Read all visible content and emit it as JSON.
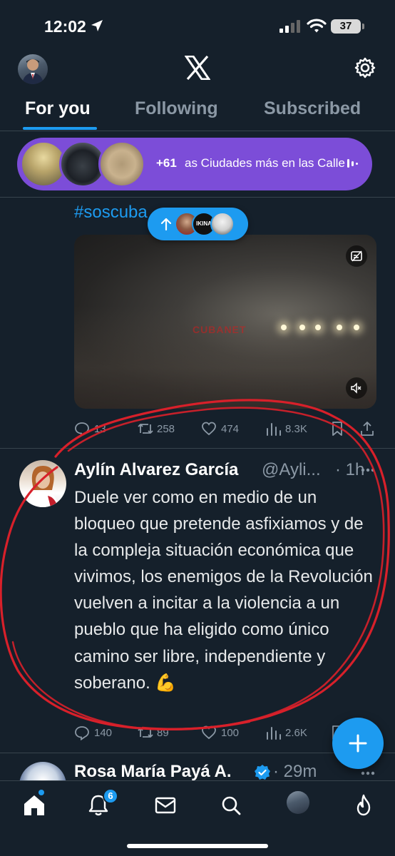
{
  "status_bar": {
    "time": "12:02",
    "battery": "37"
  },
  "header": {
    "logo": "X",
    "icons": [
      "avatar",
      "x-logo-icon",
      "gear-icon"
    ]
  },
  "tabs": [
    {
      "label": "For you",
      "active": true
    },
    {
      "label": "Following",
      "active": false
    },
    {
      "label": "Subscribed",
      "active": false
    }
  ],
  "spaces": {
    "count": "+61",
    "title": "as Ciudades más en las Calles"
  },
  "tweet1": {
    "hashtag": "#soscuba",
    "watermark": "CUBANET",
    "stats": {
      "replies": "13",
      "reposts": "258",
      "likes": "474",
      "views": "8.3K"
    }
  },
  "new_posts_pill": {
    "icon": "arrow-up-icon",
    "avatar_label": "IKINA"
  },
  "tweet2": {
    "name": "Aylín Alvarez García",
    "handle": "@Ayli...",
    "time": "· 1h",
    "text": "Duele ver como en medio de un bloqueo que pretende asfixiamos y de la compleja situación económica que vivimos, los enemigos de la Revolución vuelven a incitar a la violencia a un pueblo que ha eligido como único camino ser libre, independiente y soberano. 💪",
    "stats": {
      "replies": "140",
      "reposts": "89",
      "likes": "100",
      "views": "2.6K"
    }
  },
  "tweet3": {
    "name": "Rosa María Payá A.",
    "time": "· 29m"
  },
  "bottom_nav": {
    "notifications_badge": "6"
  },
  "colors": {
    "background": "#15202b",
    "accent": "#1d9bf0",
    "spaces": "#7c4dd8",
    "annotation": "#d8202a"
  }
}
